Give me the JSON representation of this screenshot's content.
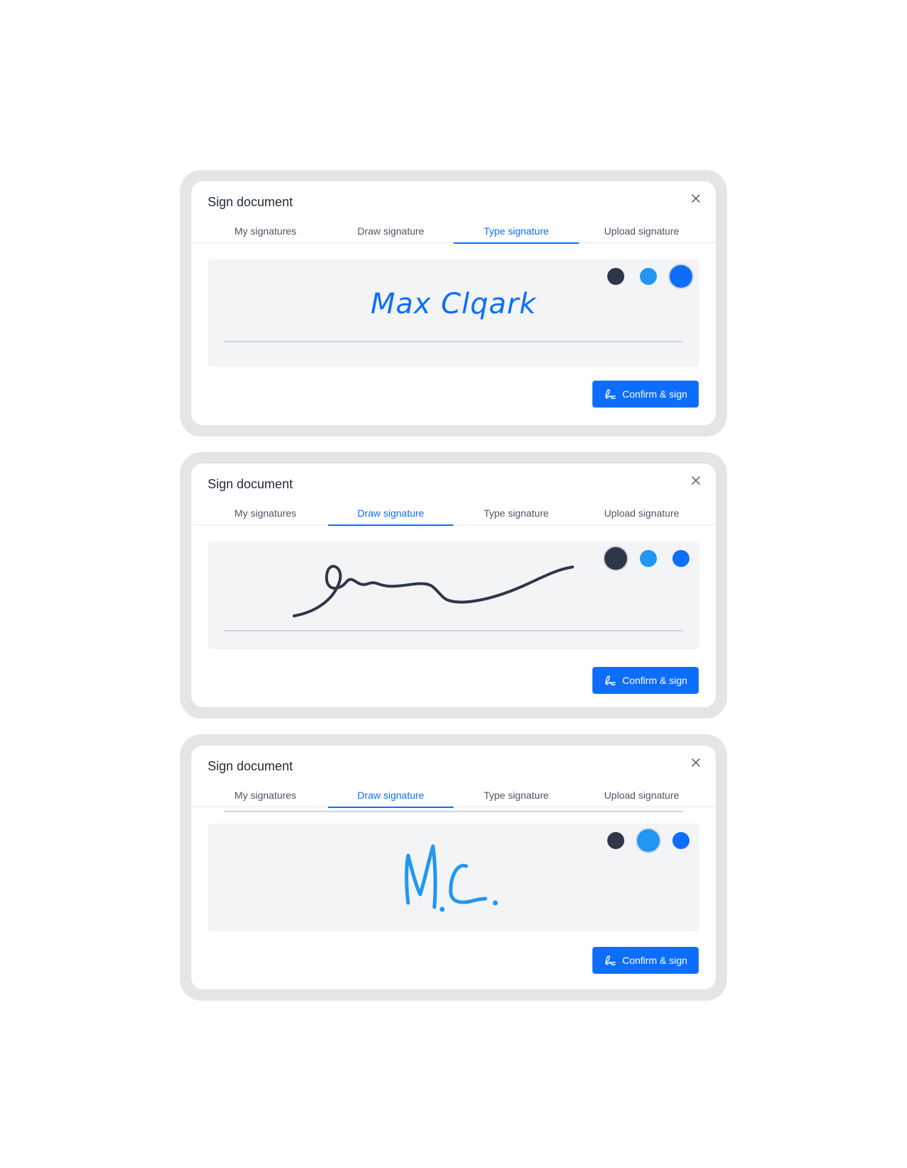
{
  "colors": {
    "accent": "#0d6efd",
    "ink_dark": "#2d3748",
    "ink_light_blue": "#2196f3",
    "ink_blue": "#0d6efd",
    "pad_background": "#f2f4f6",
    "frame_background": "#e5e5e5"
  },
  "dialogs": [
    {
      "title": "Sign document",
      "tabs": [
        {
          "label": "My signatures",
          "active": false
        },
        {
          "label": "Draw signature",
          "active": false
        },
        {
          "label": "Type signature",
          "active": true
        },
        {
          "label": "Upload signature",
          "active": false
        }
      ],
      "swatches": [
        {
          "color": "#2d3748",
          "selected": false
        },
        {
          "color": "#2196f3",
          "selected": false
        },
        {
          "color": "#0d6efd",
          "selected": true
        }
      ],
      "signature_text": "Max Clqark",
      "confirm_label": "Confirm & sign",
      "close_icon": "close-icon"
    },
    {
      "title": "Sign document",
      "tabs": [
        {
          "label": "My signatures",
          "active": false
        },
        {
          "label": "Draw signature",
          "active": true
        },
        {
          "label": "Type signature",
          "active": false
        },
        {
          "label": "Upload signature",
          "active": false
        }
      ],
      "swatches": [
        {
          "color": "#2d3748",
          "selected": true
        },
        {
          "color": "#2196f3",
          "selected": false
        },
        {
          "color": "#0d6efd",
          "selected": false
        }
      ],
      "confirm_label": "Confirm & sign",
      "close_icon": "close-icon"
    },
    {
      "title": "Sign document",
      "tabs": [
        {
          "label": "My signatures",
          "active": false
        },
        {
          "label": "Draw signature",
          "active": true
        },
        {
          "label": "Type signature",
          "active": false
        },
        {
          "label": "Upload signature",
          "active": false
        }
      ],
      "swatches": [
        {
          "color": "#2d3748",
          "selected": false
        },
        {
          "color": "#2196f3",
          "selected": true
        },
        {
          "color": "#0d6efd",
          "selected": false
        }
      ],
      "confirm_label": "Confirm & sign",
      "close_icon": "close-icon"
    }
  ]
}
